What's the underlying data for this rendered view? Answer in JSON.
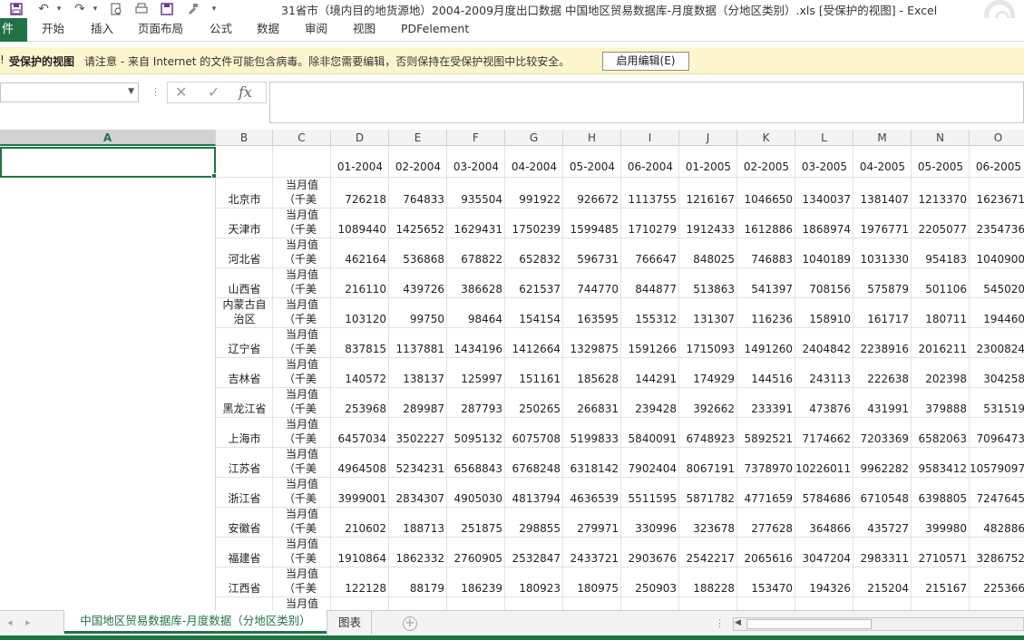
{
  "window": {
    "title": "31省市（境内目的地货源地）2004-2009月度出口数据 中国地区贸易数据库-月度数据（分地区类别）.xls  [受保护的视图] - Excel"
  },
  "ribbon": {
    "file_tab": "件",
    "tabs": [
      "开始",
      "插入",
      "页面布局",
      "公式",
      "数据",
      "审阅",
      "视图",
      "PDFelement"
    ]
  },
  "protected_view": {
    "title": "受保护的视图",
    "message": "请注意 - 来自 Internet 的文件可能包含病毒。除非您需要编辑，否则保持在受保护视图中比较安全。",
    "button_label": "启用编辑(E)"
  },
  "formula_bar": {
    "cancel_symbol": "✕",
    "enter_symbol": "✓",
    "fx_label": "fx"
  },
  "grid": {
    "column_letters": [
      "A",
      "B",
      "C",
      "D",
      "E",
      "F",
      "G",
      "H",
      "I",
      "J",
      "K",
      "L",
      "M",
      "N",
      "O"
    ],
    "selected_column": "A",
    "date_headers": [
      "01-2004",
      "02-2004",
      "03-2004",
      "04-2004",
      "05-2004",
      "06-2004",
      "01-2005",
      "02-2005",
      "03-2005",
      "04-2005",
      "05-2005",
      "06-2005"
    ],
    "unit_line1": "当月值",
    "unit_line2": "（千美",
    "rows": [
      {
        "region": "北京市",
        "values": [
          "726218",
          "764833",
          "935504",
          "991922",
          "926672",
          "1113755",
          "1216167",
          "1046650",
          "1340037",
          "1381407",
          "1213370",
          "1623671"
        ]
      },
      {
        "region": "天津市",
        "values": [
          "1089440",
          "1425652",
          "1629431",
          "1750239",
          "1599485",
          "1710279",
          "1912433",
          "1612886",
          "1868974",
          "1976771",
          "2205077",
          "2354736"
        ]
      },
      {
        "region": "河北省",
        "values": [
          "462164",
          "536868",
          "678822",
          "652832",
          "596731",
          "766647",
          "848025",
          "746883",
          "1040189",
          "1031330",
          "954183",
          "1040900"
        ]
      },
      {
        "region": "山西省",
        "values": [
          "216110",
          "439726",
          "386628",
          "621537",
          "744770",
          "844877",
          "513863",
          "541397",
          "708156",
          "575879",
          "501106",
          "545020"
        ]
      },
      {
        "region_line1": "内蒙古自",
        "region_line2": "治区",
        "values": [
          "103120",
          "99750",
          "98464",
          "154154",
          "163595",
          "155312",
          "131307",
          "116236",
          "158910",
          "161717",
          "180711",
          "194460"
        ]
      },
      {
        "region": "辽宁省",
        "values": [
          "837815",
          "1137881",
          "1434196",
          "1412664",
          "1329875",
          "1591266",
          "1715093",
          "1491260",
          "2404842",
          "2238916",
          "2016211",
          "2300824"
        ]
      },
      {
        "region": "吉林省",
        "values": [
          "140572",
          "138137",
          "125997",
          "151161",
          "185628",
          "144291",
          "174929",
          "144516",
          "243113",
          "222638",
          "202398",
          "304258"
        ]
      },
      {
        "region": "黑龙江省",
        "values": [
          "253968",
          "289987",
          "287793",
          "250265",
          "266831",
          "239428",
          "392662",
          "233391",
          "473876",
          "431991",
          "379888",
          "531519"
        ]
      },
      {
        "region": "上海市",
        "values": [
          "6457034",
          "3502227",
          "5095132",
          "6075708",
          "5199833",
          "5840091",
          "6748923",
          "5892521",
          "7174662",
          "7203369",
          "6582063",
          "7096473"
        ]
      },
      {
        "region": "江苏省",
        "values": [
          "4964508",
          "5234231",
          "6568843",
          "6768248",
          "6318142",
          "7902404",
          "8067191",
          "7378970",
          "10226011",
          "9962282",
          "9583412",
          "10579097"
        ]
      },
      {
        "region": "浙江省",
        "values": [
          "3999001",
          "2834307",
          "4905030",
          "4813794",
          "4636539",
          "5511595",
          "5871782",
          "4771659",
          "5784686",
          "6710548",
          "6398805",
          "7247645"
        ]
      },
      {
        "region": "安徽省",
        "values": [
          "210602",
          "188713",
          "251875",
          "298855",
          "279971",
          "330996",
          "323678",
          "277628",
          "364866",
          "435727",
          "399980",
          "482886"
        ]
      },
      {
        "region": "福建省",
        "values": [
          "1910864",
          "1862332",
          "2760905",
          "2532847",
          "2433721",
          "2903676",
          "2542217",
          "2065616",
          "3047204",
          "2983311",
          "2710571",
          "3286752"
        ]
      },
      {
        "region": "江西省",
        "values": [
          "122128",
          "88179",
          "186239",
          "180923",
          "180975",
          "250903",
          "188228",
          "153470",
          "194326",
          "215204",
          "215167",
          "225366"
        ]
      }
    ]
  },
  "sheets": {
    "tabs": [
      "中国地区贸易数据库-月度数据（分地区类别）",
      "图表"
    ],
    "active_index": 0,
    "add_symbol": "+"
  },
  "colors": {
    "accent": "#217346",
    "protected_bar": "#fdf6cd"
  }
}
